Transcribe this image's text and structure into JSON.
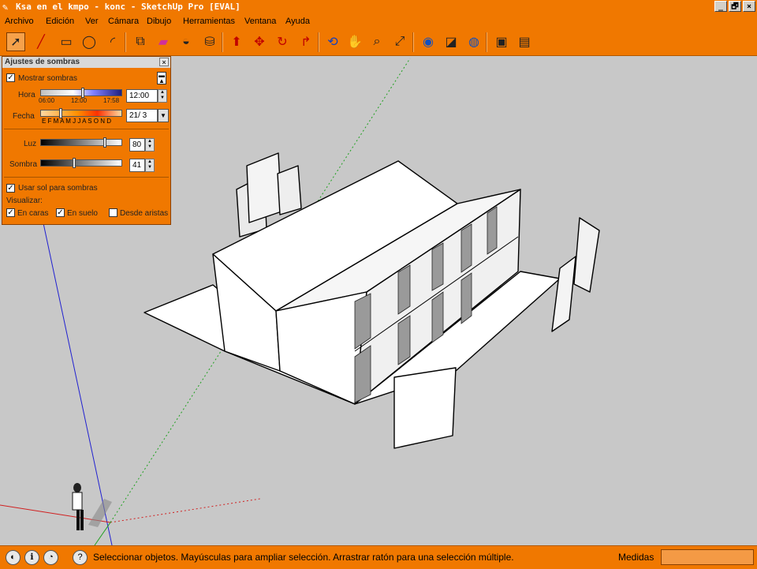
{
  "window": {
    "title": "Ksa en el kmpo - konc - SketchUp Pro [EVAL]",
    "buttons": [
      "_",
      "🗗",
      "×"
    ]
  },
  "menu": [
    "Archivo",
    "Edición",
    "Ver",
    "Cámara",
    "Dibujo",
    "Herramientas",
    "Ventana",
    "Ayuda"
  ],
  "toolbar_icons": [
    "select-icon",
    "pencil-icon",
    "rectangle-icon",
    "circle-icon",
    "arc-icon",
    "make-component-icon",
    "eraser-icon",
    "tape-measure-icon",
    "paint-bucket-icon",
    "push-pull-icon",
    "move-icon",
    "rotate-icon",
    "follow-me-icon",
    "orbit-icon",
    "pan-icon",
    "zoom-icon",
    "zoom-extents-icon",
    "get-models-icon",
    "share-model-icon",
    "google-earth-icon",
    "component-icon",
    "share-component-icon"
  ],
  "shadows_panel": {
    "title": "Ajustes de sombras",
    "close": "×",
    "show_shadows": "Mostrar sombras",
    "hora_label": "Hora",
    "hora_ticks": [
      "06:00",
      "12:00",
      "17:58"
    ],
    "hora_value": "12:00",
    "fecha_label": "Fecha",
    "months": "E F M A M J J A S O N D",
    "fecha_value": "21/ 3",
    "luz_label": "Luz",
    "luz_value": "80",
    "luz_level": 80,
    "sombra_label": "Sombra",
    "sombra_value": "41",
    "sombra_level": 41,
    "use_sun": "Usar sol para sombras",
    "visualize": "Visualizar:",
    "on_faces": "En caras",
    "on_ground": "En suelo",
    "from_edges": "Desde aristas",
    "checked": "✓"
  },
  "status": {
    "text": "Seleccionar objetos. Mayúsculas para ampliar selección. Arrastrar ratón para una selección múltiple.",
    "measure_label": "Medidas",
    "icons": [
      "geo-location-icon",
      "credits-icon",
      "help-icon",
      "question-icon"
    ]
  }
}
